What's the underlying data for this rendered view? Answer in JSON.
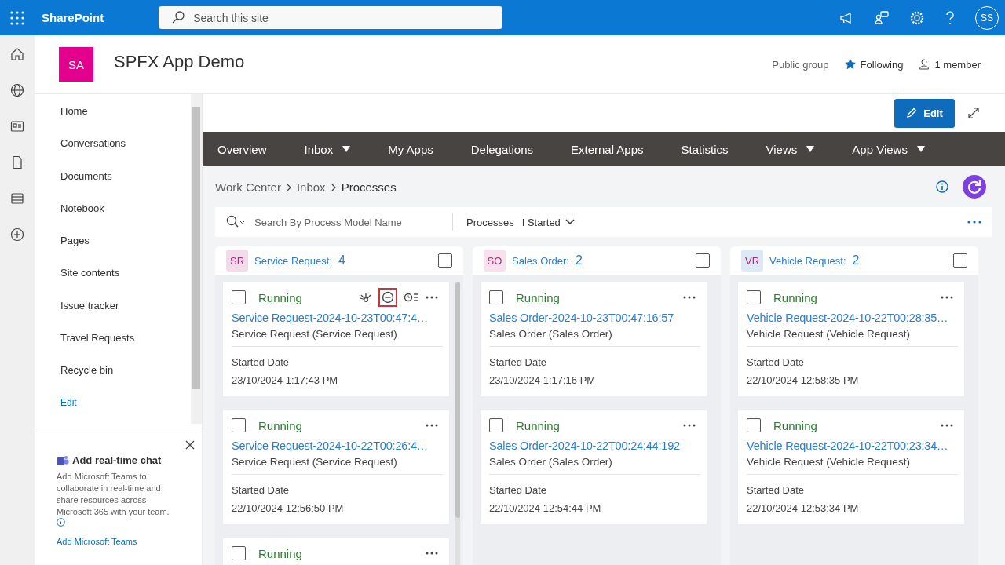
{
  "top_bar": {
    "app_name": "SharePoint",
    "search": {
      "placeholder": "Search this site"
    },
    "avatar": "SS"
  },
  "site": {
    "logo": "SA",
    "title": "SPFX App Demo",
    "group_type": "Public group",
    "following": {
      "label": "Following",
      "on": true
    },
    "members": "1 member"
  },
  "left_nav": {
    "items": [
      {
        "label": "Home",
        "kind": "item"
      },
      {
        "label": "Conversations",
        "kind": "item"
      },
      {
        "label": "Documents",
        "kind": "item"
      },
      {
        "label": "Notebook",
        "kind": "item"
      },
      {
        "label": "Pages",
        "kind": "item"
      },
      {
        "label": "Site contents",
        "kind": "item"
      },
      {
        "label": "Issue tracker",
        "kind": "item"
      },
      {
        "label": "Travel Requests",
        "kind": "item"
      },
      {
        "label": "Recycle bin",
        "kind": "item"
      },
      {
        "label": "Edit",
        "kind": "link"
      }
    ]
  },
  "teams_panel": {
    "title": "Add real-time chat",
    "text": "Add Microsoft Teams to collaborate in real-time and share resources across Microsoft 365 with your team.",
    "link": "Add Microsoft Teams"
  },
  "edit_button": "Edit",
  "app_nav": [
    {
      "label": "Overview",
      "dropdown": false
    },
    {
      "label": "Inbox",
      "dropdown": true
    },
    {
      "label": "My Apps",
      "dropdown": false
    },
    {
      "label": "Delegations",
      "dropdown": false
    },
    {
      "label": "External Apps",
      "dropdown": false
    },
    {
      "label": "Statistics",
      "dropdown": false
    },
    {
      "label": "Views",
      "dropdown": true
    },
    {
      "label": "App Views",
      "dropdown": true
    }
  ],
  "breadcrumb": [
    "Work Center",
    "Inbox",
    "Processes"
  ],
  "toolbar": {
    "search": {
      "placeholder": "Search By Process Model Name"
    },
    "filter_label": "Processes",
    "filter_value": "I Started"
  },
  "columns": [
    {
      "badge": "SR",
      "color": "#f3dcea",
      "title": "Service Request:",
      "count": "4",
      "checked": false,
      "cards": [
        {
          "checked": false,
          "status": "Running",
          "title": "Service Request-2024-10-23T00:47:4…",
          "subtitle": "Service Request (Service Request)",
          "date_label": "Started Date",
          "date": "23/10/2024 1:17:43 PM",
          "actions": [
            {
              "kind": "network",
              "highlighted": false
            },
            {
              "kind": "minus",
              "highlighted": true
            },
            {
              "kind": "history",
              "highlighted": false
            }
          ]
        },
        {
          "checked": false,
          "status": "Running",
          "title": "Service Request-2024-10-22T00:26:4…",
          "subtitle": "Service Request (Service Request)",
          "date_label": "Started Date",
          "date": "22/10/2024 12:56:50 PM"
        },
        {
          "checked": false,
          "status": "Running"
        }
      ]
    },
    {
      "badge": "SO",
      "color": "#f7e1ec",
      "title": "Sales Order:",
      "count": "2",
      "checked": false,
      "cards": [
        {
          "checked": false,
          "status": "Running",
          "title": "Sales Order-2024-10-23T00:47:16:57",
          "subtitle": "Sales Order (Sales Order)",
          "date_label": "Started Date",
          "date": "23/10/2024 1:17:16 PM"
        },
        {
          "checked": false,
          "status": "Running",
          "title": "Sales Order-2024-10-22T00:24:44:192",
          "subtitle": "Sales Order (Sales Order)",
          "date_label": "Started Date",
          "date": "22/10/2024 12:54:44 PM"
        }
      ]
    },
    {
      "badge": "VR",
      "color": "#dde9f5",
      "title": "Vehicle Request:",
      "count": "2",
      "checked": false,
      "cards": [
        {
          "checked": false,
          "status": "Running",
          "title": "Vehicle Request-2024-10-22T00:28:35…",
          "subtitle": "Vehicle Request (Vehicle Request)",
          "date_label": "Started Date",
          "date": "22/10/2024 12:58:35 PM"
        },
        {
          "checked": false,
          "status": "Running",
          "title": "Vehicle Request-2024-10-22T00:23:34…",
          "subtitle": "Vehicle Request (Vehicle Request)",
          "date_label": "Started Date",
          "date": "22/10/2024 12:53:34 PM"
        }
      ]
    }
  ]
}
